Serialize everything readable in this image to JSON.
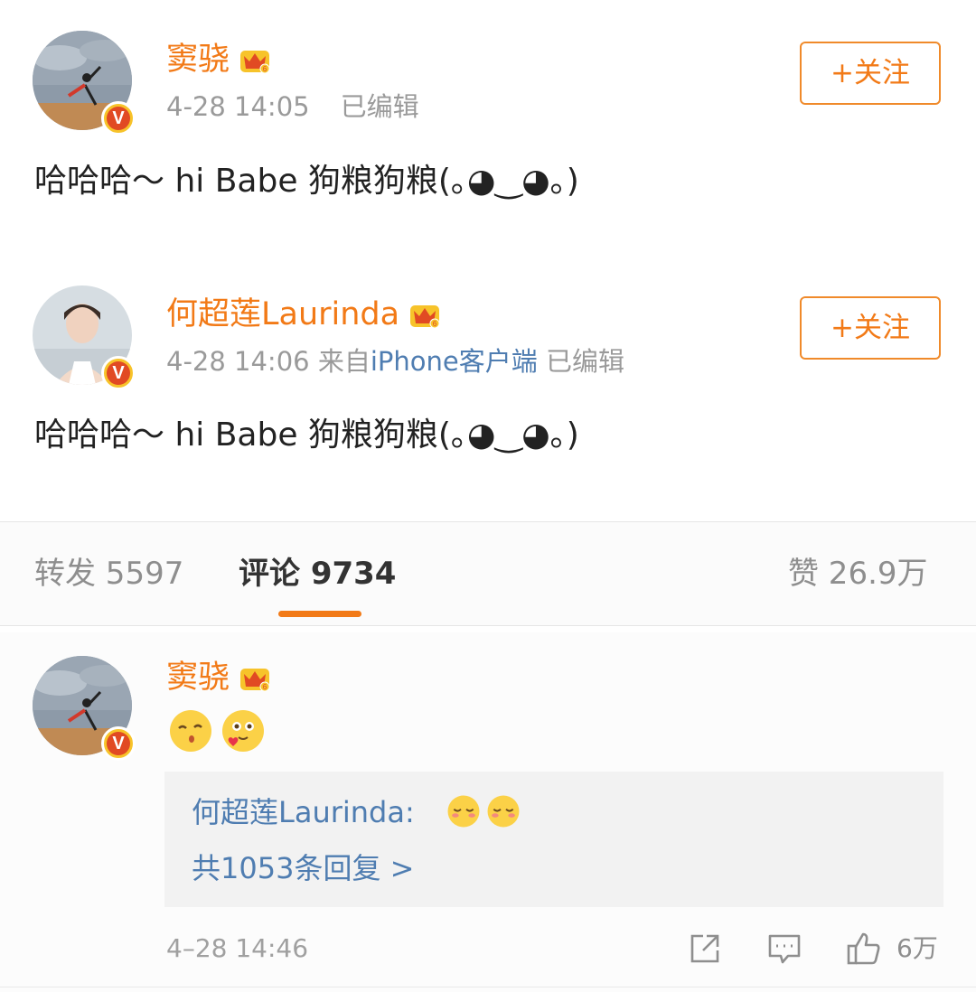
{
  "posts": [
    {
      "username": "窦骁",
      "time": "4-28 14:05",
      "source_prefix": "",
      "source": "",
      "edited": "已编辑",
      "follow_label": "+关注",
      "text": "哈哈哈～ hi Babe 狗粮狗粮(｡◕‿◕｡)"
    },
    {
      "username": "何超莲Laurinda",
      "time": "4-28 14:06",
      "source_prefix": "来自",
      "source": "iPhone客户端",
      "edited": "已编辑",
      "follow_label": "+关注",
      "text": "哈哈哈～ hi Babe 狗粮狗粮(｡◕‿◕｡)"
    }
  ],
  "tabs": {
    "repost": "转发 5597",
    "comment": "评论 9734",
    "like": "赞 26.9万"
  },
  "comment": {
    "username": "窦骁",
    "emojis": [
      "kiss-emoji",
      "love-emoji"
    ],
    "reply": {
      "author_prefix": "何超莲Laurinda:",
      "emojis": [
        "shy-emoji",
        "shy-emoji"
      ],
      "more": "共1053条回复 >"
    },
    "time": "4–28 14:46",
    "like_count": "6万"
  },
  "colors": {
    "accent": "#f27a17",
    "link": "#4f7db1",
    "meta": "#9a9a9a",
    "vip_gold": "#f7c32a",
    "verified_red": "#e14a23"
  },
  "icons": [
    "crown-vip-icon",
    "verified-v-icon",
    "share-icon",
    "comment-icon",
    "thumbs-up-icon"
  ]
}
